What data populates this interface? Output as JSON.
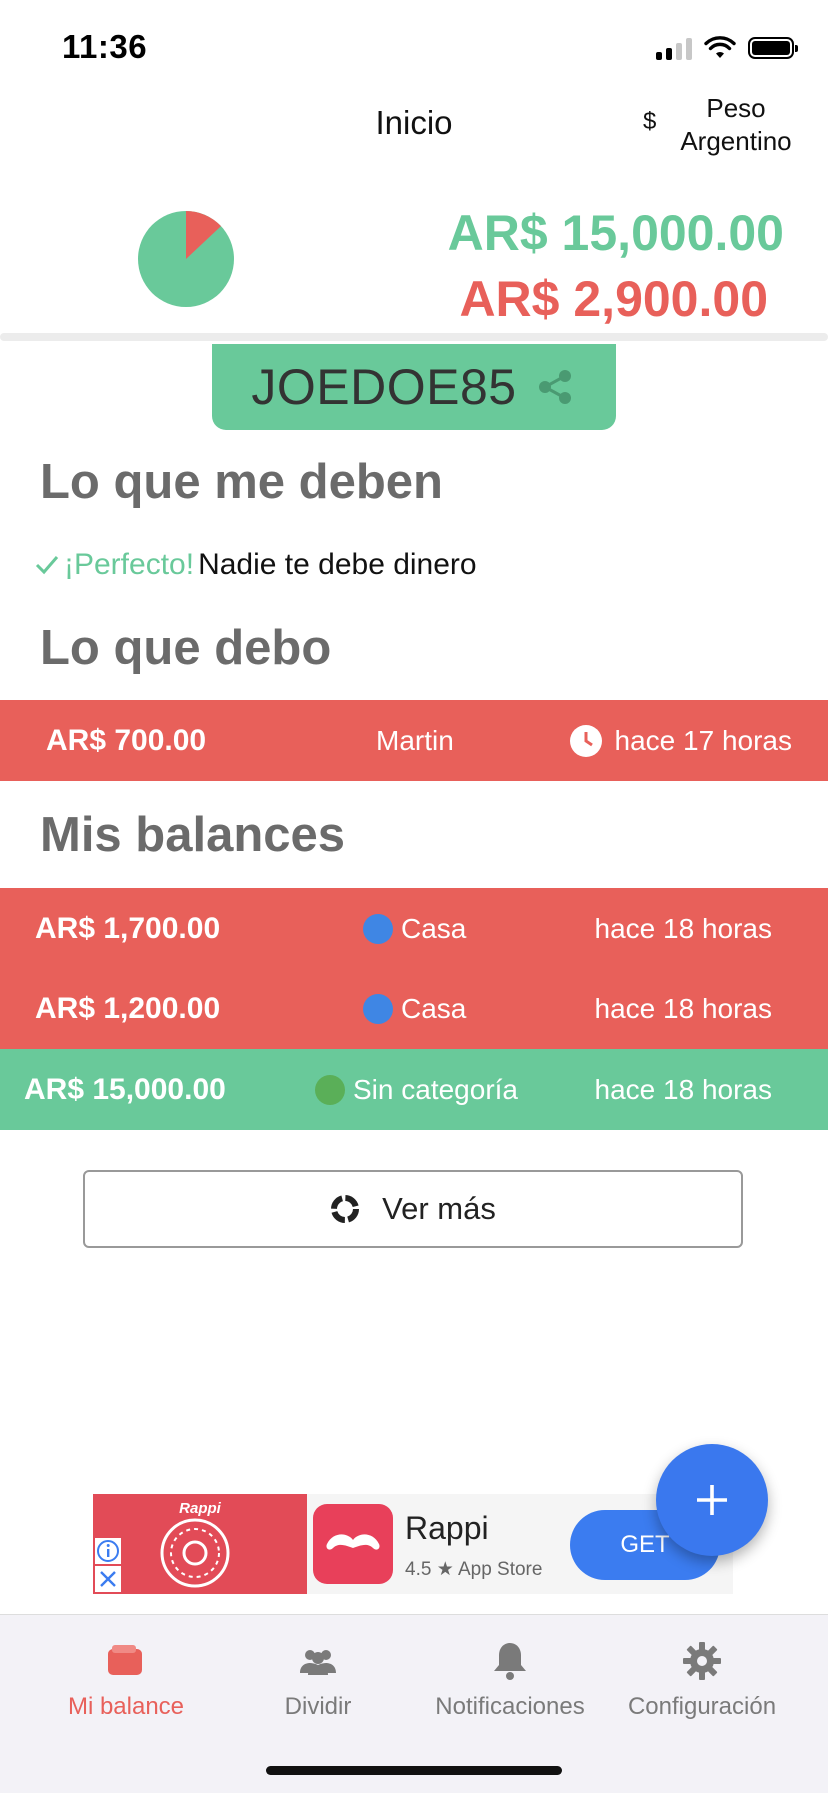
{
  "status_bar": {
    "time": "11:36"
  },
  "header": {
    "title": "Inicio",
    "currency_symbol": "$",
    "currency_name": "Peso Argentino"
  },
  "summary": {
    "positive_amount": "AR$ 15,000.00",
    "negative_amount": "AR$ 2,900.00",
    "pie_negative_fraction": 0.13,
    "colors": {
      "positive": "#69c99a",
      "negative": "#e8605a"
    }
  },
  "user_code": {
    "code": "JOEDOE85"
  },
  "owed_to_me": {
    "title": "Lo que me deben",
    "status_highlight": "¡Perfecto!",
    "status_text": "Nadie te debe dinero"
  },
  "i_owe": {
    "title": "Lo que debo",
    "rows": [
      {
        "amount": "AR$ 700.00",
        "person": "Martin",
        "time": "hace 17 horas"
      }
    ]
  },
  "my_balances": {
    "title": "Mis balances",
    "rows": [
      {
        "amount": "AR$ 1,700.00",
        "category": "Casa",
        "time": "hace 18 horas",
        "dot_color": "#3f86e4"
      },
      {
        "amount": "AR$ 1,200.00",
        "category": "Casa",
        "time": "hace 18 horas",
        "dot_color": "#3f86e4"
      },
      {
        "amount": "AR$ 15,000.00",
        "category": "Sin categoría",
        "time": "hace 18 horas",
        "dot_color": "#5aaf58"
      }
    ]
  },
  "more_button": {
    "label": "Ver más"
  },
  "ad": {
    "brand": "Rappi",
    "app_name": "Rappi",
    "rating": "4.5 ★ App Store",
    "cta": "GET"
  },
  "tabs": [
    {
      "label": "Mi balance",
      "icon": "wallet-icon",
      "active": true
    },
    {
      "label": "Dividir",
      "icon": "people-icon",
      "active": false
    },
    {
      "label": "Notificaciones",
      "icon": "bell-icon",
      "active": false
    },
    {
      "label": "Configuración",
      "icon": "gear-icon",
      "active": false
    }
  ]
}
